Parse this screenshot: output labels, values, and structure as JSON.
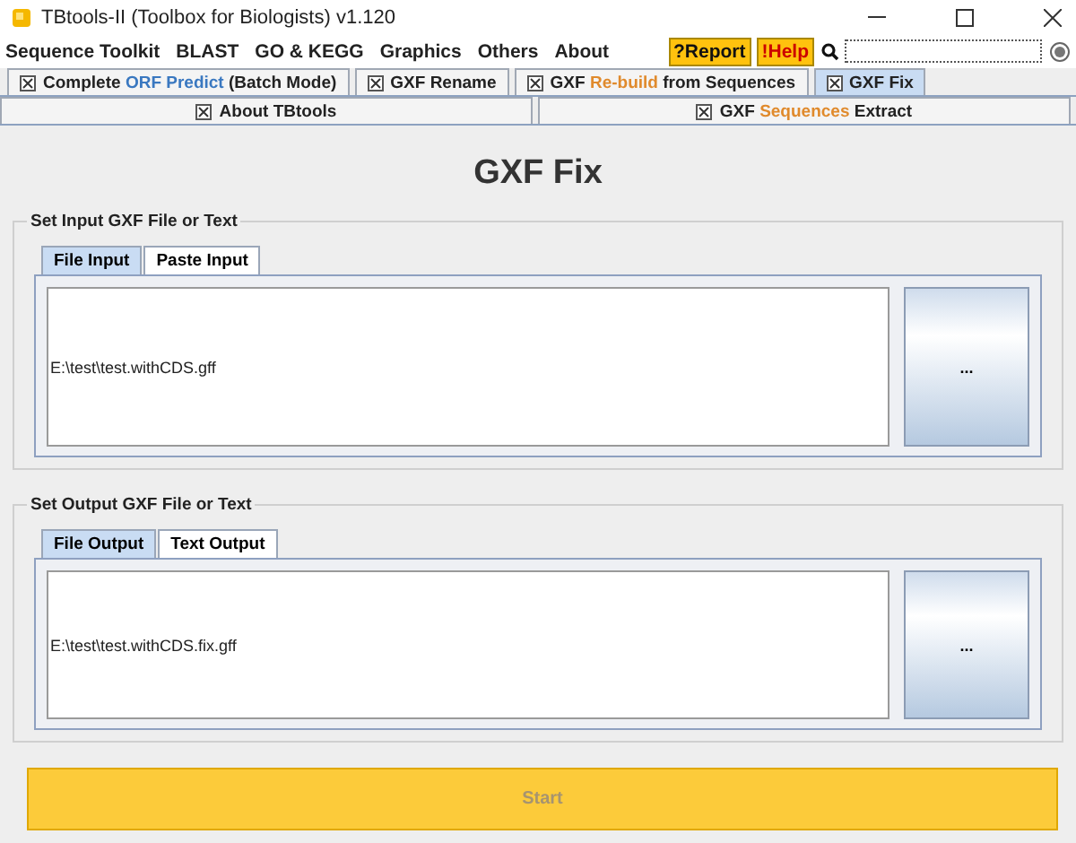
{
  "window": {
    "title": "TBtools-II (Toolbox for Biologists) v1.120"
  },
  "menu": [
    "Sequence Toolkit",
    "BLAST",
    "GO & KEGG",
    "Graphics",
    "Others",
    "About"
  ],
  "help_buttons": [
    "?Report",
    "!Help"
  ],
  "tab_rows": [
    {
      "tabs": [
        {
          "selected": false,
          "parts": [
            {
              "text": "Complete "
            },
            {
              "text": "ORF Predict",
              "color": "#3a78c0"
            },
            {
              "text": " (Batch Mode)"
            }
          ]
        },
        {
          "selected": false,
          "parts": [
            {
              "text": "GXF Rename"
            }
          ]
        },
        {
          "selected": false,
          "parts": [
            {
              "text": "GXF "
            },
            {
              "text": "Re-build",
              "color": "#e08a2c"
            },
            {
              "text": " from Sequences"
            }
          ]
        },
        {
          "selected": true,
          "parts": [
            {
              "text": "GXF Fix"
            }
          ]
        }
      ]
    },
    {
      "tabs": [
        {
          "selected": false,
          "parts": [
            {
              "text": "About TBtools"
            }
          ]
        },
        {
          "selected": false,
          "parts": [
            {
              "text": "GXF "
            },
            {
              "text": "Sequences",
              "color": "#e08a2c"
            },
            {
              "text": " Extract"
            }
          ]
        }
      ]
    }
  ],
  "heading": "GXF Fix",
  "groups": [
    {
      "title": "Set Input GXF File or Text",
      "tabs": [
        {
          "label": "File Input",
          "selected": true
        },
        {
          "label": "Paste Input",
          "selected": false
        }
      ],
      "value": "E:\\test\\test.withCDS.gff",
      "browse": "..."
    },
    {
      "title": "Set Output GXF File or Text",
      "tabs": [
        {
          "label": "File Output",
          "selected": true
        },
        {
          "label": "Text Output",
          "selected": false
        }
      ],
      "value": "E:\\test\\test.withCDS.fix.gff",
      "browse": "..."
    }
  ],
  "start": {
    "label": "Start",
    "disabled": true
  }
}
